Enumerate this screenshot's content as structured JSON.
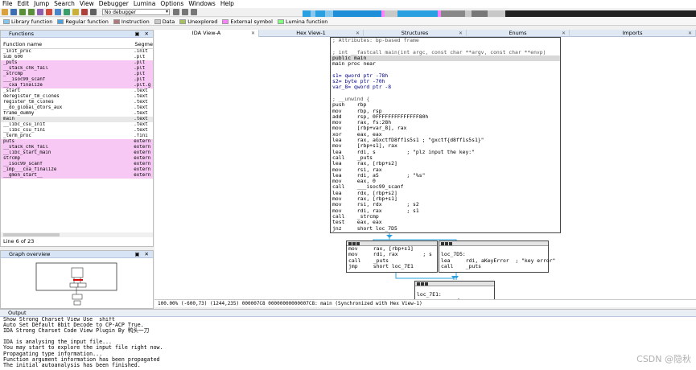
{
  "menu": [
    "File",
    "Edit",
    "Jump",
    "Search",
    "View",
    "Debugger",
    "Lumina",
    "Options",
    "Windows",
    "Help"
  ],
  "toolbar": {
    "debugger_select": "No debugger",
    "icons": [
      "open-file-icon",
      "save-icon",
      "back-icon",
      "forward-icon",
      "run-icon",
      "pause-icon",
      "stop-icon",
      "breakpoint-icon"
    ]
  },
  "legend": [
    {
      "label": "Library function",
      "color": "#80c8f0"
    },
    {
      "label": "Regular function",
      "color": "#4aa3df"
    },
    {
      "label": "Instruction",
      "color": "#b07878"
    },
    {
      "label": "Data",
      "color": "#c8c8c8"
    },
    {
      "label": "Unexplored",
      "color": "#a8c060"
    },
    {
      "label": "External symbol",
      "color": "#ff80ff"
    },
    {
      "label": "Lumina function",
      "color": "#80ff80"
    }
  ],
  "functions": {
    "title": "Functions",
    "col_name": "Function name",
    "col_segment": "Segme",
    "rows": [
      {
        "name": "_init_proc",
        "seg": ".init",
        "imp": false
      },
      {
        "name": "sub_600",
        "seg": ".plt",
        "imp": false
      },
      {
        "name": "_puts",
        "seg": ".plt",
        "imp": true
      },
      {
        "name": "__stack_chk_fail",
        "seg": ".plt",
        "imp": true
      },
      {
        "name": "_strcmp",
        "seg": ".plt",
        "imp": true
      },
      {
        "name": "___isoc99_scanf",
        "seg": ".plt",
        "imp": true
      },
      {
        "name": "__cxa_finalize",
        "seg": ".plt.g",
        "imp": true
      },
      {
        "name": "_start",
        "seg": ".text",
        "imp": false
      },
      {
        "name": "deregister_tm_clones",
        "seg": ".text",
        "imp": false
      },
      {
        "name": "register_tm_clones",
        "seg": ".text",
        "imp": false
      },
      {
        "name": "__do_global_dtors_aux",
        "seg": ".text",
        "imp": false
      },
      {
        "name": "frame_dummy",
        "seg": ".text",
        "imp": false
      },
      {
        "name": "main",
        "seg": ".text",
        "imp": false,
        "sel": true
      },
      {
        "name": "__libc_csu_init",
        "seg": ".text",
        "imp": false
      },
      {
        "name": "__libc_csu_fini",
        "seg": ".text",
        "imp": false
      },
      {
        "name": "_term_proc",
        "seg": ".fini",
        "imp": false
      },
      {
        "name": "puts",
        "seg": "extern",
        "imp": true
      },
      {
        "name": "__stack_chk_fail",
        "seg": "extern",
        "imp": true
      },
      {
        "name": "__libc_start_main",
        "seg": "extern",
        "imp": true
      },
      {
        "name": "strcmp",
        "seg": "extern",
        "imp": true
      },
      {
        "name": "__isoc99_scanf",
        "seg": "extern",
        "imp": true
      },
      {
        "name": "_imp___cxa_finalize",
        "seg": "extern",
        "imp": true
      },
      {
        "name": "__gmon_start__",
        "seg": "extern",
        "imp": true
      }
    ],
    "status": "Line 6 of 23"
  },
  "graph_overview": {
    "title": "Graph overview"
  },
  "tabs": [
    {
      "label": "IDA View-A",
      "active": true
    },
    {
      "label": "Hex View-1",
      "active": false
    },
    {
      "label": "Structures",
      "active": false
    },
    {
      "label": "Enums",
      "active": false
    },
    {
      "label": "Imports",
      "active": false
    }
  ],
  "main_block": {
    "lines": [
      "; Attributes: bp-based frame",
      "",
      "; int __fastcall main(int argc, const char **argv, const char **envp)",
      "public main",
      "main proc near",
      "",
      "s1= qword ptr -78h",
      "s2= byte ptr -70h",
      "var_8= qword ptr -8",
      "",
      "; __unwind {",
      "push    rbp",
      "mov     rbp, rsp",
      "add     rsp, 0FFFFFFFFFFFFFF80h",
      "mov     rax, fs:28h",
      "mov     [rbp+var_8], rax",
      "xor     eax, eax",
      "lea     rax, aGxctfD8ff1s5s1 ; \"gxctf{d8ff1s5s1}\"",
      "mov     [rbp+s1], rax",
      "lea     rdi, s          ; \"plz input the key:\"",
      "call    _puts",
      "lea     rax, [rbp+s2]",
      "mov     rsi, rax",
      "lea     rdi, aS         ; \"%s\"",
      "mov     eax, 0",
      "call    ___isoc99_scanf",
      "lea     rdx, [rbp+s2]",
      "mov     rax, [rbp+s1]",
      "mov     rsi, rdx        ; s2",
      "mov     rdi, rax        ; s1",
      "call    _strcmp",
      "test    eax, eax",
      "jnz     short loc_7D5"
    ]
  },
  "left_block": {
    "lines": [
      "mov     rax, [rbp+s1]",
      "mov     rdi, rax        ; s",
      "call    _puts",
      "jmp     short loc_7E1"
    ]
  },
  "right_block": {
    "lines": [
      "",
      "loc_7D5:",
      "lea     rdi, aKeyError  ; \"key error\"",
      "call    _puts"
    ]
  },
  "bottom_block": {
    "lines": [
      "",
      "loc_7E1:",
      "mov     eax, 0"
    ]
  },
  "status_line": "100.00% (-600,73) (1244,235) 000007C8 00000000000007C8: main (Synchronized with Hex View-1)",
  "output": {
    "title": "Output",
    "lines": [
      "Show Strong Charset View Use  shift",
      "Auto Set Default 8bit Decode to CP-ACP True.",
      "IDA Strong Charset Code View Plugin By 鸭头一刀",
      "",
      "IDA is analysing the input file...",
      "You may start to explore the input file right now.",
      "Propagating type information...",
      "Function argument information has been propagated",
      "The initial autoanalysis has been finished."
    ],
    "watermark": "CSDN @隐秋"
  }
}
